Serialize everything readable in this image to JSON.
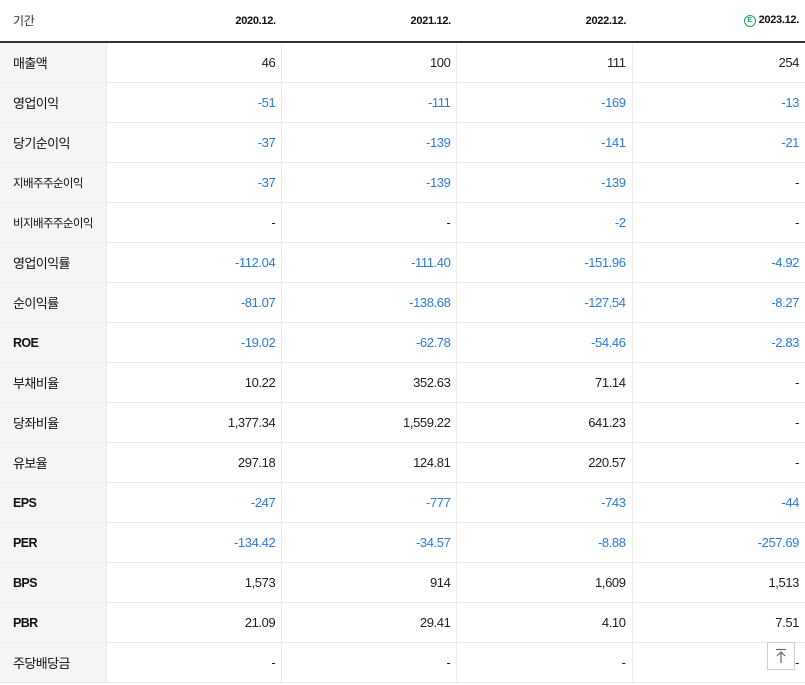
{
  "header": {
    "label": "기간",
    "periods": [
      "2020.12.",
      "2021.12.",
      "2022.12.",
      "2023.12."
    ],
    "estimate_badge": "E"
  },
  "rows": [
    {
      "label": "매출액",
      "values": [
        "46",
        "100",
        "111",
        "254"
      ]
    },
    {
      "label": "영업이익",
      "values": [
        "-51",
        "-111",
        "-169",
        "-13"
      ]
    },
    {
      "label": "당기순이익",
      "values": [
        "-37",
        "-139",
        "-141",
        "-21"
      ]
    },
    {
      "label": "지배주주순이익",
      "values": [
        "-37",
        "-139",
        "-139",
        "-"
      ]
    },
    {
      "label": "비지배주주순이익",
      "values": [
        "-",
        "-",
        "-2",
        "-"
      ]
    },
    {
      "label": "영업이익률",
      "values": [
        "-112.04",
        "-111.40",
        "-151.96",
        "-4.92"
      ]
    },
    {
      "label": "순이익률",
      "values": [
        "-81.07",
        "-138.68",
        "-127.54",
        "-8.27"
      ]
    },
    {
      "label": "ROE",
      "values": [
        "-19.02",
        "-62.78",
        "-54.46",
        "-2.83"
      ]
    },
    {
      "label": "부채비율",
      "values": [
        "10.22",
        "352.63",
        "71.14",
        "-"
      ]
    },
    {
      "label": "당좌비율",
      "values": [
        "1,377.34",
        "1,559.22",
        "641.23",
        "-"
      ]
    },
    {
      "label": "유보율",
      "values": [
        "297.18",
        "124.81",
        "220.57",
        "-"
      ]
    },
    {
      "label": "EPS",
      "values": [
        "-247",
        "-777",
        "-743",
        "-44"
      ]
    },
    {
      "label": "PER",
      "values": [
        "-134.42",
        "-34.57",
        "-8.88",
        "-257.69"
      ]
    },
    {
      "label": "BPS",
      "values": [
        "1,573",
        "914",
        "1,609",
        "1,513"
      ]
    },
    {
      "label": "PBR",
      "values": [
        "21.09",
        "29.41",
        "4.10",
        "7.51"
      ]
    },
    {
      "label": "주당배당금",
      "values": [
        "-",
        "-",
        "-",
        "-"
      ]
    }
  ],
  "scroll_top": {
    "icon": "arrow-up-icon",
    "glyph": "↑"
  },
  "colors": {
    "negative": "#2b7bd9",
    "estimate": "#1aa35b"
  }
}
